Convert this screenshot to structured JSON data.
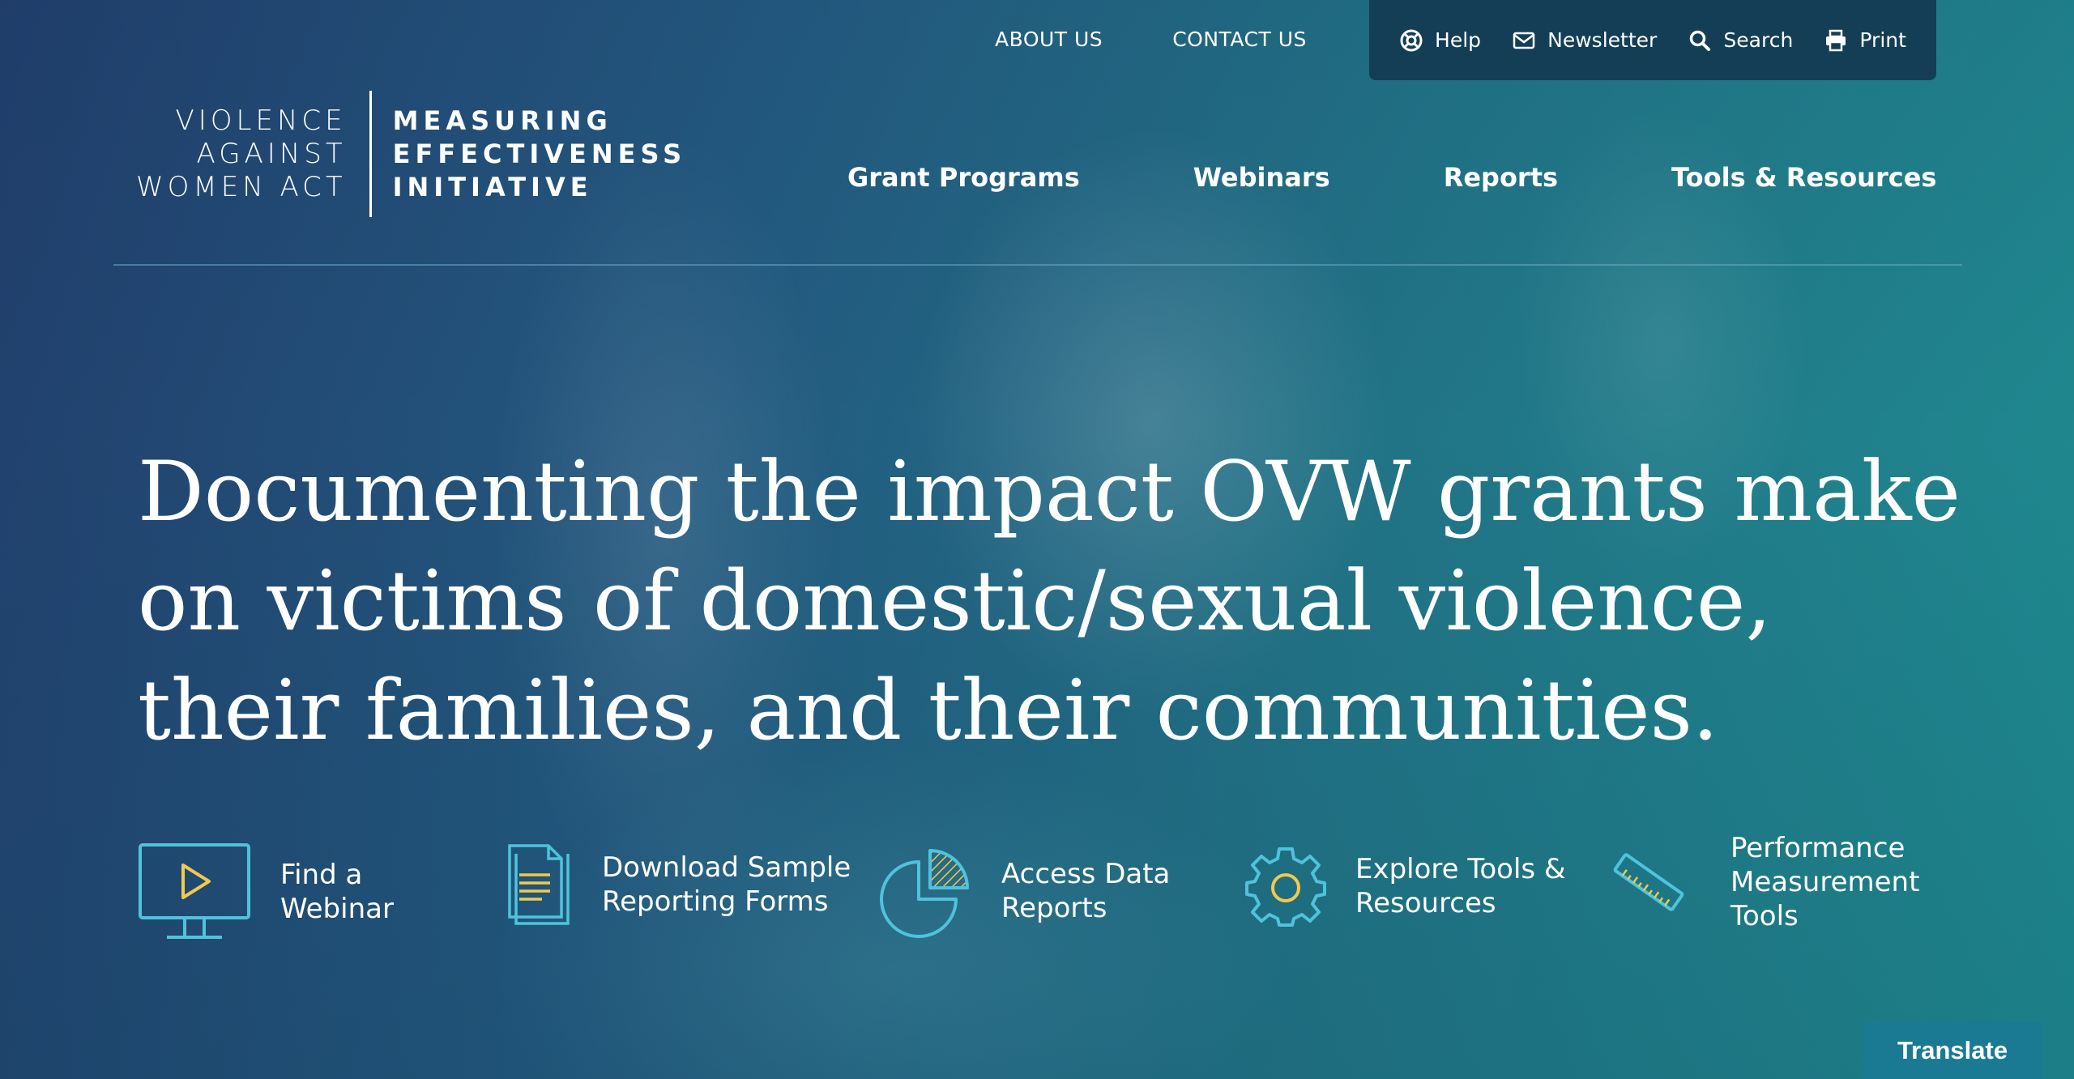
{
  "utility_nav": {
    "about_label": "ABOUT US",
    "contact_label": "CONTACT US"
  },
  "tools_bar": {
    "help_label": "Help",
    "newsletter_label": "Newsletter",
    "search_label": "Search",
    "print_label": "Print"
  },
  "logo": {
    "left_line1": "VIOLENCE",
    "left_line2": "AGAINST",
    "left_line3": "WOMEN ACT",
    "right_line1": "MEASURING",
    "right_line2": "EFFECTIVENESS",
    "right_line3": "INITIATIVE"
  },
  "main_nav": {
    "items": [
      "Grant Programs",
      "Webinars",
      "Reports",
      "Tools & Resources"
    ]
  },
  "hero": {
    "headline_line1": "Documenting the impact OVW grants make",
    "headline_line2": "on victims of domestic/sexual violence,",
    "headline_line3": "their families, and their communities."
  },
  "quick_links": [
    {
      "line1": "Find a",
      "line2": "Webinar",
      "icon": "monitor-play-icon"
    },
    {
      "line1": "Download Sample",
      "line2": "Reporting Forms",
      "icon": "document-icon"
    },
    {
      "line1": "Access Data",
      "line2": "Reports",
      "icon": "pie-chart-icon"
    },
    {
      "line1": "Explore Tools &",
      "line2": "Resources",
      "icon": "gear-icon"
    },
    {
      "line1": "Performance",
      "line2": "Measurement",
      "line3": "Tools",
      "icon": "ruler-icon"
    }
  ],
  "translate": {
    "label": "Translate"
  },
  "colors": {
    "icon_outline": "#4fc3dc",
    "icon_accent": "#f2c94c",
    "tool_bar_bg": "#133e56",
    "translate_bg": "#1a7a93"
  }
}
